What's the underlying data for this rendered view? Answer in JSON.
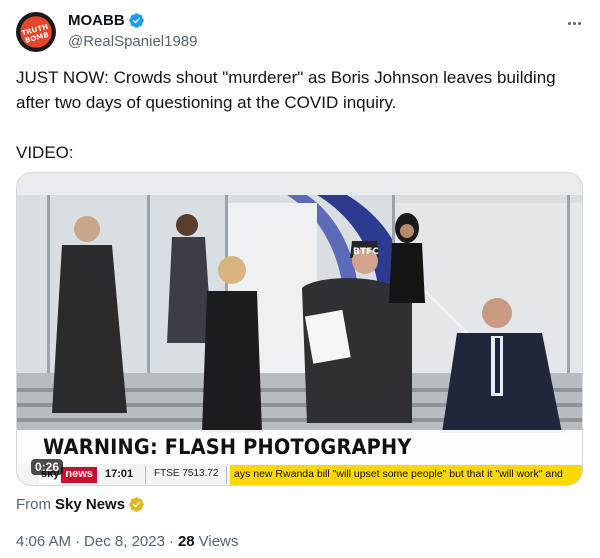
{
  "author": {
    "display_name": "MOABB",
    "handle": "@RealSpaniel1989",
    "avatar_text": "TRUTH BOMB"
  },
  "tweet": {
    "text": "JUST NOW: Crowds shout \"murderer\" as Boris Johnson leaves building after two days of questioning at the COVID inquiry.\n\nVIDEO:"
  },
  "video": {
    "overlay_warning": "WARNING: FLASH PHOTOGRAPHY",
    "duration": "0:26",
    "cap_text": "BTFC",
    "ticker": {
      "logo_sky": "sky",
      "logo_news": "news",
      "time": "17:01",
      "ftse": "FTSE 7513.72",
      "headline": "ays new Rwanda bill \"will upset some people\" but that it \"will work\" and"
    }
  },
  "source": {
    "prefix": "From",
    "name": "Sky News"
  },
  "meta": {
    "time": "4:06 AM",
    "separator": "·",
    "date": "Dec 8, 2023",
    "views_count": "28",
    "views_label": "Views"
  },
  "colors": {
    "verified_blue": "#1d9bf0",
    "business_gold": "#e2b719",
    "sky_red": "#c8102e",
    "ticker_yellow": "#fcd700"
  },
  "icons": [
    "verified-badge-icon",
    "more-options-icon",
    "business-verified-badge-icon"
  ]
}
